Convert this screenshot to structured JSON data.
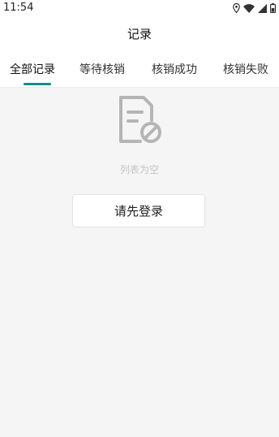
{
  "status_bar": {
    "time": "11:54",
    "icons": [
      "location-icon",
      "wifi-icon",
      "signal-icon",
      "battery-icon"
    ]
  },
  "header": {
    "title": "记录"
  },
  "tabs": [
    {
      "label": "全部记录",
      "active": true
    },
    {
      "label": "等待核销",
      "active": false
    },
    {
      "label": "核销成功",
      "active": false
    },
    {
      "label": "核销失败",
      "active": false
    }
  ],
  "empty_state": {
    "icon": "empty-list-icon",
    "message": "列表为空"
  },
  "login_button": {
    "label": "请先登录"
  },
  "colors": {
    "accent": "#1a8a8a",
    "background": "#f5f5f5",
    "empty_icon": "#b5b5b5",
    "empty_text": "#c4c4c4"
  }
}
